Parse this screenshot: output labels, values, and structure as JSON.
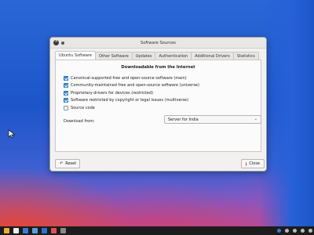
{
  "window": {
    "title": "Software Sources"
  },
  "tabs": [
    {
      "label": "Ubuntu Software",
      "active": true
    },
    {
      "label": "Other Software",
      "active": false
    },
    {
      "label": "Updates",
      "active": false
    },
    {
      "label": "Authentication",
      "active": false
    },
    {
      "label": "Additional Drivers",
      "active": false
    },
    {
      "label": "Statistics",
      "active": false
    }
  ],
  "section": {
    "heading": "Downloadable from the Internet",
    "options": [
      {
        "label": "Canonical-supported free and open-source software (main)",
        "checked": true
      },
      {
        "label": "Community-maintained free and open-source software (universe)",
        "checked": true
      },
      {
        "label": "Proprietary drivers for devices (restricted)",
        "checked": true
      },
      {
        "label": "Software restricted by copyright or legal issues (multiverse)",
        "checked": true
      },
      {
        "label": "Source code",
        "checked": false
      }
    ],
    "download_from_label": "Download from:",
    "download_from_value": "Server for India"
  },
  "buttons": {
    "reset": "Reset",
    "close": "Close"
  },
  "icons": {
    "window_close": "close-icon",
    "reset": "undo-icon",
    "close": "close-circle-icon",
    "dropdown": "chevron-down-icon",
    "pointer": "mouse-pointer-icon"
  },
  "colors": {
    "accent": "#3d8fd1",
    "close_red": "#e2413b",
    "desktop_blue": "#2661d9"
  }
}
